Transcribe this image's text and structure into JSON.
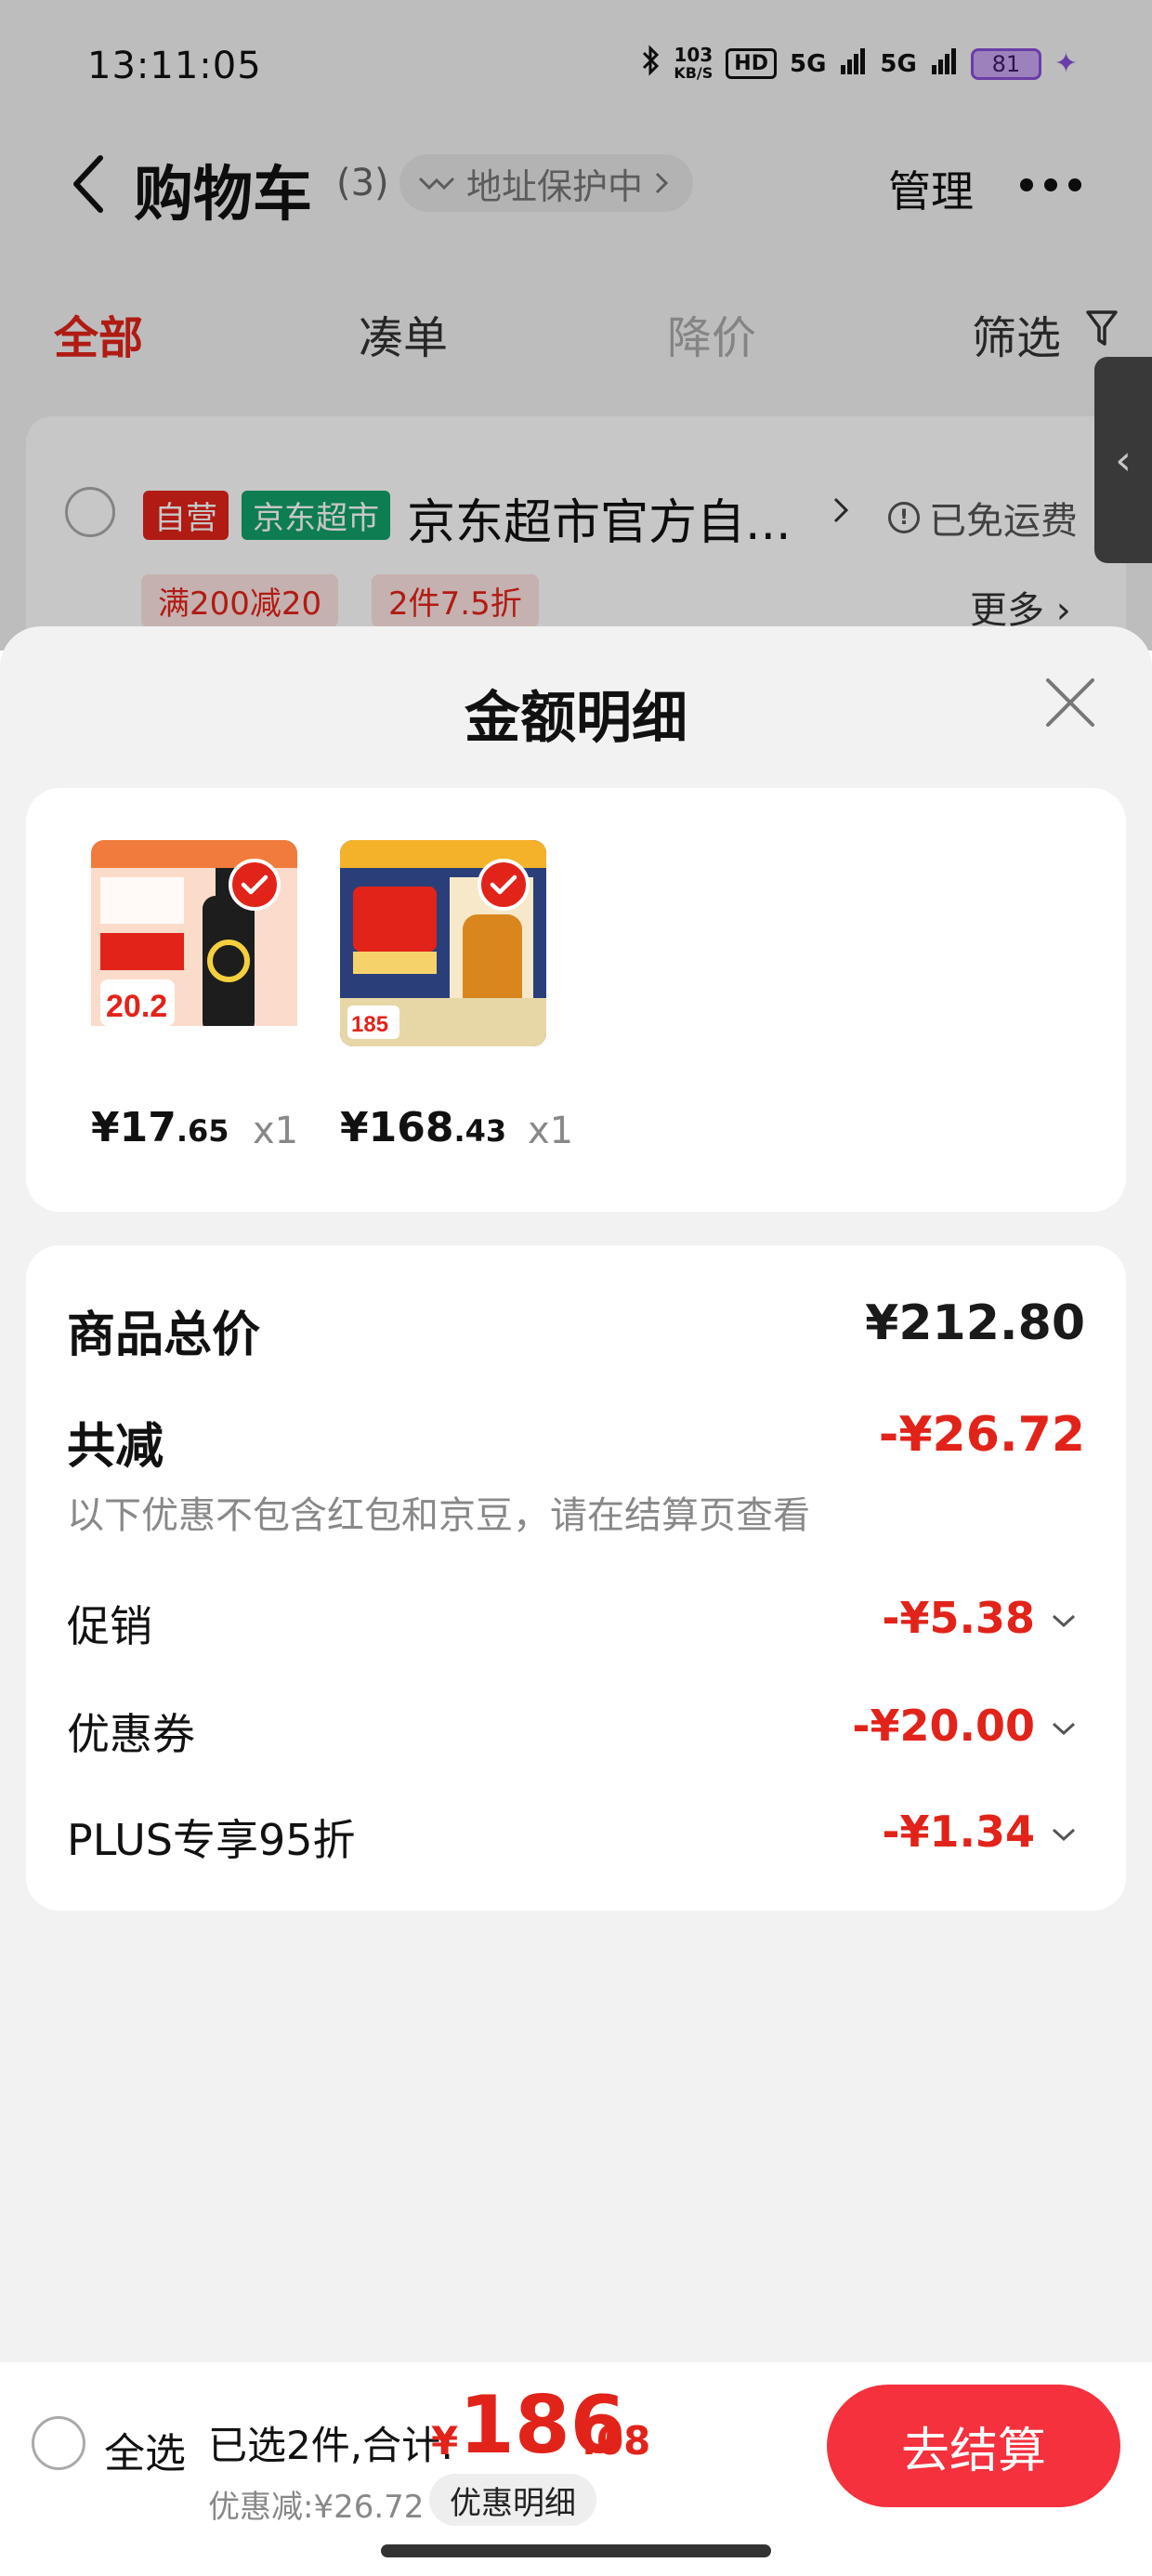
{
  "status_bar": {
    "time": "13:11:05",
    "net_speed_value": "103",
    "net_speed_unit": "KB/S",
    "hd_badge": "HD",
    "signal1": "5G",
    "signal2": "5G",
    "battery": "81"
  },
  "nav": {
    "title": "购物车",
    "count": "(3)",
    "address_protect": "地址保护中",
    "manage": "管理"
  },
  "tabs": [
    {
      "label": "全部"
    },
    {
      "label": "凑单"
    },
    {
      "label": "降价"
    },
    {
      "label": "筛选"
    }
  ],
  "shop": {
    "tag_self": "自营",
    "tag_supermarket": "京东超市",
    "name": "京东超市官方自...",
    "freight": "已免运费",
    "promos": [
      "满200减20",
      "2件7.5折"
    ],
    "more": "更多"
  },
  "sheet": {
    "title": "金额明细",
    "items": [
      {
        "price_int": "¥17",
        "price_dec": ".65",
        "qty": "x1"
      },
      {
        "price_int": "¥168",
        "price_dec": ".43",
        "qty": "x1"
      }
    ],
    "summary": {
      "total_label": "商品总价",
      "total_value": "¥212.80",
      "reduce_label": "共减",
      "reduce_value": "-¥26.72",
      "note": "以下优惠不包含红包和京豆，请在结算页查看",
      "rows": [
        {
          "label": "促销",
          "value": "-¥5.38"
        },
        {
          "label": "优惠券",
          "value": "-¥20.00"
        },
        {
          "label": "PLUS专享95折",
          "value": "-¥1.34"
        }
      ]
    }
  },
  "bottom_bar": {
    "select_all": "全选",
    "selected_total_label": "已选2件,合计:",
    "currency": "¥",
    "total_int": "186",
    "total_dec": ".08",
    "discount": "优惠减:¥26.72",
    "detail_button": "优惠明细",
    "checkout_button": "去结算"
  },
  "colors": {
    "accent_red": "#e2231a",
    "checkout_red": "#f4313d",
    "supermarket_green": "#12a06a"
  }
}
